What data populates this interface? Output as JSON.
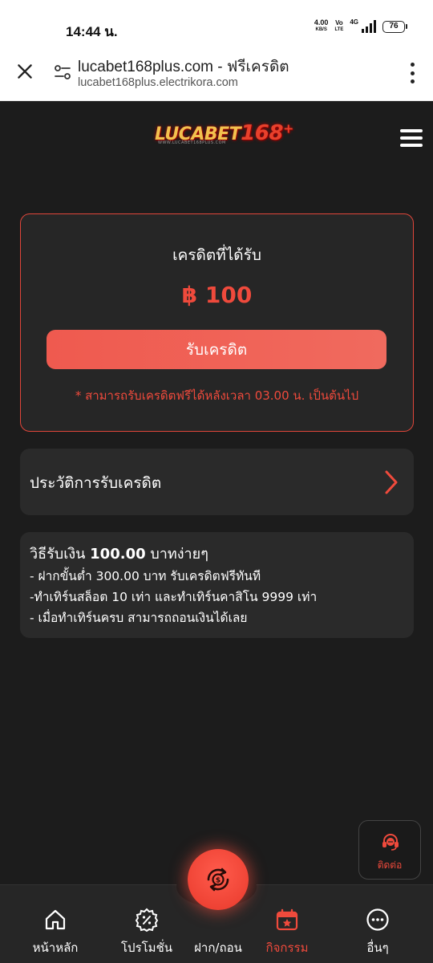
{
  "status_bar": {
    "time": "14:44 น.",
    "net_speed_value": "4.00",
    "net_speed_unit": "KB/S",
    "volte_top": "Vo",
    "volte_bottom": "LTE",
    "network_type": "4G",
    "battery": "76"
  },
  "browser": {
    "page_title": "lucabet168plus.com - ฟรีเครดิต",
    "url": "lucabet168plus.electrikora.com"
  },
  "header": {
    "logo_main": "LUCABET",
    "logo_number": "168",
    "logo_plus": "+",
    "logo_sub": "WWW.LUCABET168PLUS.COM"
  },
  "credit": {
    "label": "เครดิตที่ได้รับ",
    "amount": "฿ 100",
    "button_label": "รับเครดิต",
    "note": "* สามารถรับเครดิตฟรีได้หลังเวลา 03.00 น. เป็นต้นไป"
  },
  "history": {
    "label": "ประวัติการรับเครดิต"
  },
  "info": {
    "title_prefix": "วิธีรับเงิน ",
    "title_amount": "100.00",
    "title_suffix": " บาทง่ายๆ",
    "lines": [
      "- ฝากขั้นต่ำ 300.00 บาท รับเครดิตฟรีทันที",
      "-ทำเทิร์นสล็อต 10 เท่า และทำเทิร์นคาสิโน 9999 เท่า",
      "- เมื่อทำเทิร์นครบ สามารถถอนเงินได้เลย"
    ]
  },
  "contact": {
    "label": "ติดต่อ"
  },
  "bottom_nav": {
    "items": [
      {
        "label": "หน้าหลัก",
        "icon": "home-icon"
      },
      {
        "label": "โปรโมชั่น",
        "icon": "promotion-icon"
      },
      {
        "label": "ฝาก/ถอน",
        "icon": "deposit-withdraw-icon"
      },
      {
        "label": "กิจกรรม",
        "icon": "calendar-star-icon"
      },
      {
        "label": "อื่นๆ",
        "icon": "more-icon"
      }
    ],
    "active_index": 3
  },
  "colors": {
    "accent": "#ef4a3c",
    "background": "#1c1c1c",
    "card": "#2a2a2a"
  }
}
